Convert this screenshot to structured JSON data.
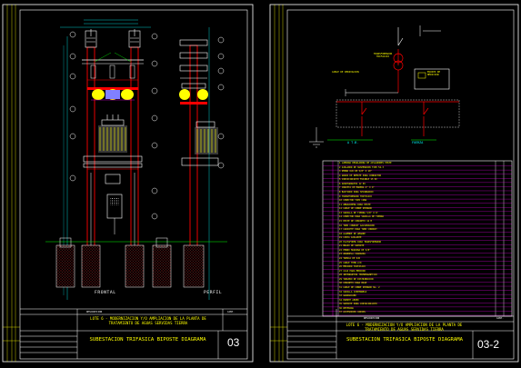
{
  "sheet_left": {
    "view_front_label": "FRONTAL",
    "view_side_label": "PERFIL",
    "notes_header": "DESCRIPCION",
    "notes_col2": "CANT.",
    "project_text": "LOTE 6 - MODERNIZACION Y/O AMPLIACION DE LA PLANTA DE TRATAMIENTO DE AGUAS SERVIDAS TIERRA",
    "title_text": "SUBESTACION TRIFASICA BIPOSTE DIAGRAMA",
    "sheet_number": "03"
  },
  "sheet_right": {
    "transformer_label": "TRANSFORMADOR TRIFASICO",
    "cable_label": "CABLE DE DERIVACION",
    "meter_label": "EQUIPO DE MEDICION",
    "atb_label": "A T.B.",
    "load_label": "FUERZA",
    "bom_header_desc": "DESCRIPCION",
    "bom_header_qty": "CANT.",
    "project_text": "LOTE 6 - MODERNIZACION Y/O AMPLIACION DE LA PLANTA DE TRATAMIENTO DE AGUAS SERVIDAS TIERRA",
    "title_text": "SUBESTACION TRIFASICA BIPOSTE DIAGRAMA",
    "sheet_number": "03-2",
    "bom_rows": [
      "1 LAMPARA REGULADORA DE AISLADORES POSTE",
      "2 AISLADOR DE SUSPENSION TIPO 52-3",
      "3 PERNO OJO DE 5/8\" X 10\"",
      "4 GRAPA DE REMATE PARA CONDUCTOR",
      "5 CORTACIRCUITO FUSIBLE 15 KV",
      "6 APARTARRAYOS 12 KV",
      "7 CRUCETA DE MADERA 4\" X 4\"",
      "8 BASTIDOR PARA SECUNDARIO",
      "9 TRANSFORMADOR TRIFASICO",
      "10 CONECTOR TIPO CUNA",
      "11 ABRAZADERA PARA POSTE",
      "12 CABLE DE COBRE DESNUDO",
      "13 VARILLA DE TIERRA 5/8\" X 8'",
      "14 CONECTOR PARA VARILLA DE TIERRA",
      "15 POSTE DE CONCRETO 12 M",
      "16 TUBO CONDUIT GALVANIZADO",
      "17 CAPACETE PARA TUBO CONDUIT",
      "18 ALAMBRE DE AMARRE",
      "19 CINTA AISLANTE",
      "20 PLATAFORMA PARA TRANSFORMADOR",
      "21 BRAZO DE SOPORTE",
      "22 PERNO MAQUINA DE 5/8\"",
      "23 ARANDELA CUADRADA",
      "24 TUERCA DE OJO",
      "25 CABLE THHN 2/0",
      "26 MEDIDOR TRIFASICO",
      "27 CAJA PARA MEDIDOR",
      "28 INTERRUPTOR TERMOMAGNETICO",
      "29 TABLERO DE DISTRIBUCION",
      "30 CONCRETO PARA BASE",
      "31 CABLE DE COBRE DESNUDO No. 2",
      "32 VARILLA COPPERWELD",
      "33 GUARDACABO",
      "34 PUENTE AEREO",
      "35 SOPORTE PARA CORTACIRCUITO",
      "36 RETENIDA",
      "37 ACCESORIOS VARIOS"
    ]
  },
  "colors": {
    "background": "#000000",
    "frame": "#ffffff",
    "title_text": "#ffff00",
    "dims": "#00ffff",
    "poles": "#ff0000",
    "insulators": "#ffff00",
    "grid_magenta": "#ff00ff",
    "ground": "#ff4040"
  }
}
